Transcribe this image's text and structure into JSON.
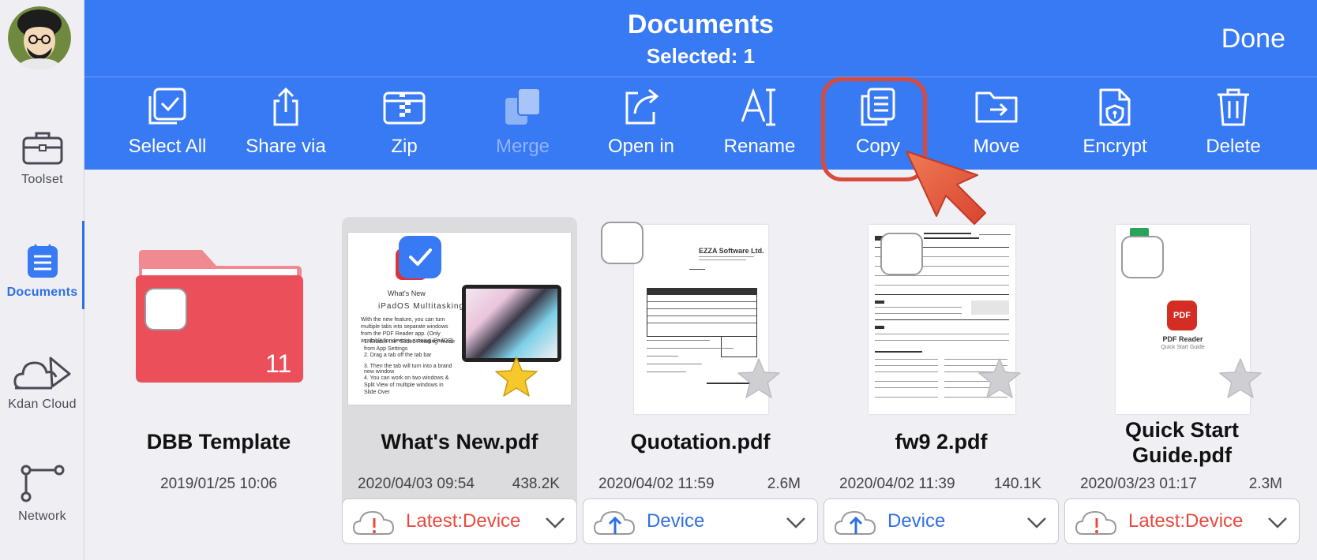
{
  "header": {
    "title": "Documents",
    "subtitle": "Selected: 1",
    "done_label": "Done"
  },
  "sidebar": {
    "items": [
      {
        "label": "Toolset",
        "icon": "toolbox-icon"
      },
      {
        "label": "Documents",
        "icon": "documents-icon",
        "active": true
      },
      {
        "label": "Kdan Cloud",
        "icon": "cloud-icon"
      },
      {
        "label": "Network",
        "icon": "network-icon"
      }
    ]
  },
  "toolbar": {
    "items": [
      {
        "label": "Select All",
        "icon": "select-all-icon"
      },
      {
        "label": "Share via",
        "icon": "share-icon"
      },
      {
        "label": "Zip",
        "icon": "zip-icon"
      },
      {
        "label": "Merge",
        "icon": "merge-icon",
        "disabled": true
      },
      {
        "label": "Open in",
        "icon": "open-in-icon"
      },
      {
        "label": "Rename",
        "icon": "rename-icon"
      },
      {
        "label": "Copy",
        "icon": "copy-icon",
        "highlighted": true
      },
      {
        "label": "Move",
        "icon": "move-icon"
      },
      {
        "label": "Encrypt",
        "icon": "encrypt-icon"
      },
      {
        "label": "Delete",
        "icon": "trash-icon"
      }
    ]
  },
  "files": [
    {
      "name": "DBB Template",
      "date": "2019/01/25 10:06",
      "size": "",
      "count": "11",
      "type": "folder"
    },
    {
      "name": "What's New.pdf",
      "date": "2020/04/03 09:54",
      "size": "438.2K",
      "sync": "Latest:Device",
      "sync_type": "warning",
      "selected": true,
      "starred": true,
      "thumb_text": {
        "t1": "What's New",
        "t2": "iPadOS Multitasking",
        "t3": "With the new feature, you can turn multiple tabs into separate windows from the PDF Reader app. (Only available for devices running iPadOS)",
        "b1": "1. Enable the \"Slided Reading\" mode from App Settings",
        "b2": "2. Drag a tab off the tab bar",
        "b3": "3. Then the tab will turn into a brand new window",
        "b4": "4. You can work on two windows & Split View of multiple windows in Slide Over"
      }
    },
    {
      "name": "Quotation.pdf",
      "date": "2020/04/02 11:59",
      "size": "2.6M",
      "sync": "Device",
      "sync_type": "upload",
      "thumb_text": {
        "company": "EZZA Software Ltd."
      }
    },
    {
      "name": "fw9 2.pdf",
      "date": "2020/04/02 11:39",
      "size": "140.1K",
      "sync": "Device",
      "sync_type": "upload"
    },
    {
      "name": "Quick Start Guide.pdf",
      "date": "2020/03/23 01:17",
      "size": "2.3M",
      "sync": "Latest:Device",
      "sync_type": "warning",
      "thumb_text": {
        "logo": "PDF",
        "name": "PDF Reader",
        "sub": "Quick Start Guide"
      }
    }
  ],
  "colors": {
    "accent": "#3879f4",
    "warning": "#e8493e",
    "link": "#2f6fe6"
  }
}
